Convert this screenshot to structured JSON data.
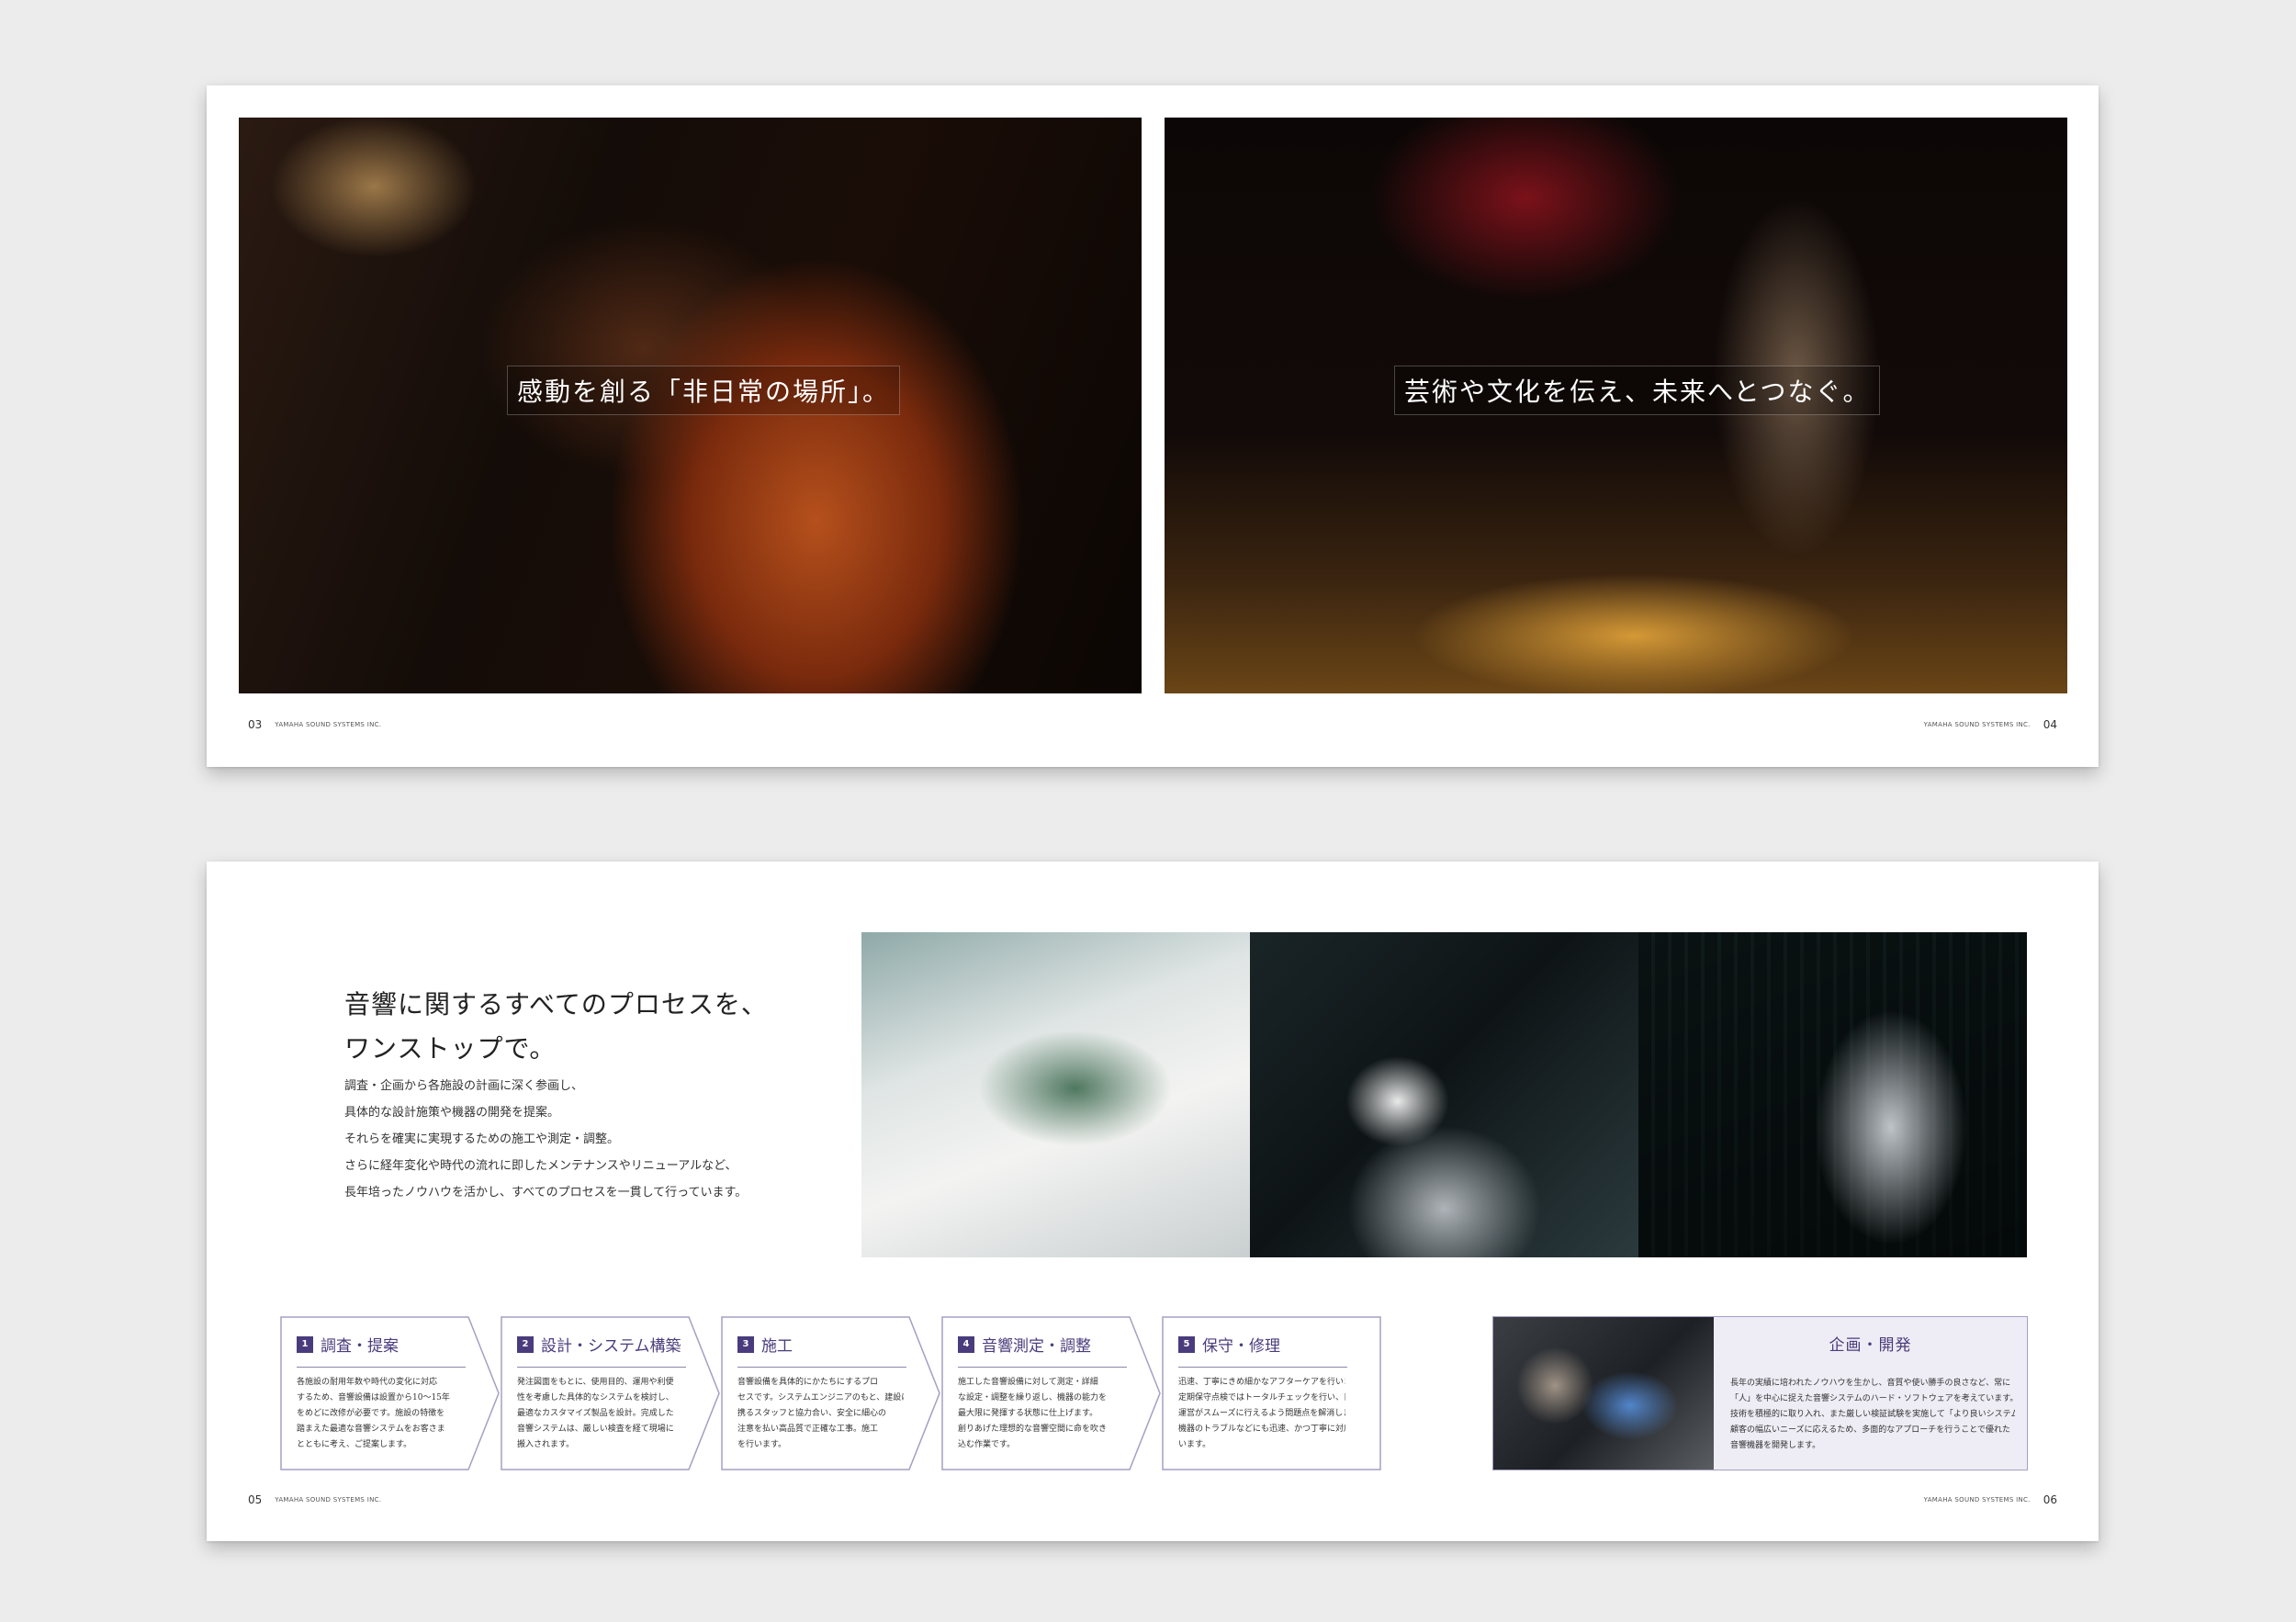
{
  "spread1": {
    "headline_left": "感動を創る「非日常の場所」。",
    "headline_right": "芸術や文化を伝え、未来へとつなぐ。",
    "folio_left": {
      "page": "03",
      "brand": "YAMAHA SOUND SYSTEMS INC."
    },
    "folio_right": {
      "page": "04",
      "brand": "YAMAHA SOUND SYSTEMS INC."
    }
  },
  "spread2": {
    "lead_title": [
      "音響に関するすべてのプロセスを、",
      "ワンストップで。"
    ],
    "lead_body": [
      "調査・企画から各施設の計画に深く参画し、",
      "具体的な設計施策や機器の開発を提案。",
      "それらを確実に実現するための施工や測定・調整。",
      "さらに経年変化や時代の流れに即したメンテナンスやリニューアルなど、",
      "長年培ったノウハウを活かし、すべてのプロセスを一貫して行っています。"
    ],
    "steps": [
      {
        "num": "1",
        "title": "調査・提案",
        "body": [
          "各施設の耐用年数や時代の変化に対応",
          "するため、音響設備は設置から10～15年",
          "をめどに改修が必要です。施設の特徴を",
          "踏まえた最適な音響システムをお客さま",
          "とともに考え、ご提案します。"
        ]
      },
      {
        "num": "2",
        "title": "設計・システム構築",
        "body": [
          "発注図面をもとに、使用目的、運用や利便",
          "性を考慮した具体的なシステムを検討し、",
          "最適なカスタマイズ製品を設計。完成した",
          "音響システムは、厳しい検査を経て現場に",
          "搬入されます。"
        ]
      },
      {
        "num": "3",
        "title": "施工",
        "body": [
          "音響設備を具体的にかたちにするプロ",
          "セスです。システムエンジニアのもと、建設に",
          "携るスタッフと協力合い、安全に細心の",
          "注意を払い高品質で正確な工事。施工",
          "を行います。"
        ]
      },
      {
        "num": "4",
        "title": "音響測定・調整",
        "body": [
          "施工した音響設備に対して測定・詳細",
          "な設定・調整を繰り返し、機器の能力を",
          "最大限に発揮する状態に仕上げます。",
          "創りあげた理想的な音響空間に命を吹き",
          "込む作業です。"
        ]
      },
      {
        "num": "5",
        "title": "保守・修理",
        "body": [
          "迅速、丁寧にきめ細かなアフターケアを行います。",
          "定期保守点検ではトータルチェックを行い、日常の",
          "運営がスムーズに行えるよう問題点を解消します。",
          "機器のトラブルなどにも迅速、かつ丁寧に対応して",
          "います。"
        ]
      }
    ],
    "dev": {
      "title": "企画・開発",
      "body": [
        "長年の実績に培われたノウハウを生かし、音質や使い勝手の良さなど、常に",
        "「人」を中心に捉えた音響システムのハード・ソフトウェアを考えています。最新の",
        "技術を積極的に取り入れ、また厳しい検証試験を実施して「より良いシステムへ」。",
        "顧客の幅広いニーズに応えるため、多面的なアプローチを行うことで優れた",
        "音響機器を開発します。"
      ]
    },
    "folio_left": {
      "page": "05",
      "brand": "YAMAHA SOUND SYSTEMS INC."
    },
    "folio_right": {
      "page": "06",
      "brand": "YAMAHA SOUND SYSTEMS INC."
    }
  },
  "colors": {
    "accent": "#4a3c7c",
    "accent_light": "#eeecf4"
  }
}
